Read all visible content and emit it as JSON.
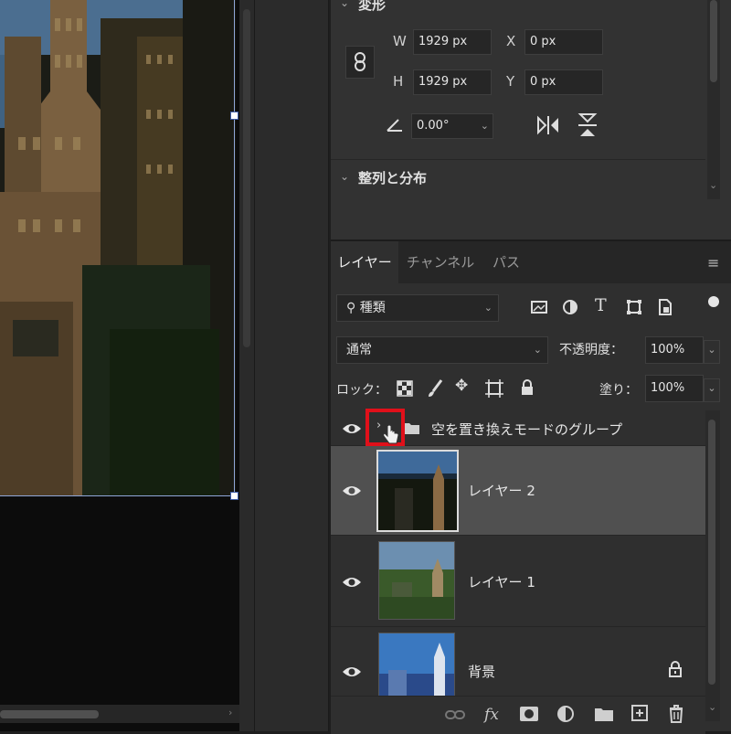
{
  "properties": {
    "transform_title": "変形",
    "w_label": "W",
    "w_value": "1929 px",
    "x_label": "X",
    "x_value": "0 px",
    "h_label": "H",
    "h_value": "1929 px",
    "y_label": "Y",
    "y_value": "0 px",
    "angle_value": "0.00°",
    "align_title": "整列と分布"
  },
  "layers_panel": {
    "tabs": [
      "レイヤー",
      "チャンネル",
      "パス"
    ],
    "filter_kind": "種類",
    "blend_mode": "通常",
    "opacity_label": "不透明度：",
    "opacity_value": "100%",
    "lock_label": "ロック：",
    "fill_label": "塗り：",
    "fill_value": "100%",
    "group_name": "空を置き換えモードのグループ",
    "layers": [
      {
        "name": "レイヤー 2"
      },
      {
        "name": "レイヤー 1"
      },
      {
        "name": "背景"
      }
    ]
  },
  "colors": {
    "highlight_box": "#e0101a",
    "selection": "#8fa6d8"
  },
  "icons": {
    "link": "link-icon",
    "eye": "eye-icon",
    "lock": "lock-icon",
    "flip_h": "flip-horizontal-icon",
    "flip_v": "flip-vertical-icon",
    "fx": "fx-icon",
    "trash": "trash-icon"
  }
}
